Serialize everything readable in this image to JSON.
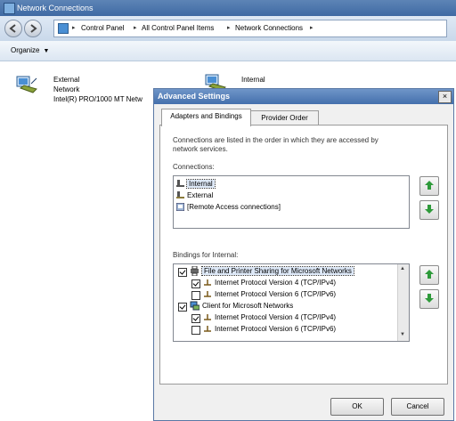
{
  "window": {
    "title": "Network Connections"
  },
  "address_bar": {
    "crumbs": [
      "Control Panel",
      "All Control Panel Items",
      "Network Connections"
    ]
  },
  "toolbar": {
    "organize_label": "Organize"
  },
  "connections_view": {
    "items": [
      {
        "name": "External",
        "sub": "Network",
        "device": "Intel(R) PRO/1000 MT Netw"
      },
      {
        "name": "Internal"
      }
    ]
  },
  "dialog": {
    "title": "Advanced Settings",
    "close_glyph": "×",
    "tabs": [
      "Adapters and Bindings",
      "Provider Order"
    ],
    "description_line1": "Connections are listed in the order in which they are accessed by",
    "description_line2": "network services.",
    "connections_label": "Connections:",
    "connections": [
      "Internal",
      "External",
      "[Remote Access connections]"
    ],
    "bindings_label": "Bindings for Internal:",
    "bindings": [
      {
        "label": "File and Printer Sharing for Microsoft Networks",
        "checked": true,
        "level": 0
      },
      {
        "label": "Internet Protocol Version 4 (TCP/IPv4)",
        "checked": true,
        "level": 1
      },
      {
        "label": "Internet Protocol Version 6 (TCP/IPv6)",
        "checked": false,
        "level": 1
      },
      {
        "label": "Client for Microsoft Networks",
        "checked": true,
        "level": 0
      },
      {
        "label": "Internet Protocol Version 4 (TCP/IPv4)",
        "checked": true,
        "level": 1
      },
      {
        "label": "Internet Protocol Version 6 (TCP/IPv6)",
        "checked": false,
        "level": 1
      }
    ],
    "ok_label": "OK",
    "cancel_label": "Cancel",
    "colors": {
      "up_arrow": "#2e9a3a",
      "down_arrow": "#2e9a3a",
      "selection": "#dde8f7"
    }
  }
}
